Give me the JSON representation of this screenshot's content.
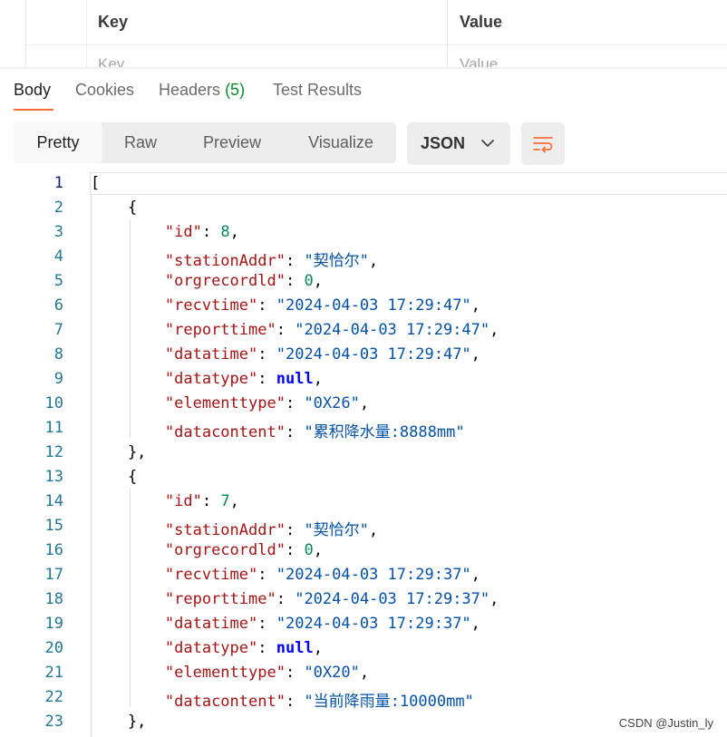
{
  "params": {
    "key_header": "Key",
    "value_header": "Value",
    "key_placeholder": "Key",
    "value_placeholder": "Value"
  },
  "tabs": [
    {
      "label": "Body"
    },
    {
      "label": "Cookies"
    },
    {
      "label": "Headers",
      "count": "(5)"
    },
    {
      "label": "Test Results"
    }
  ],
  "view_modes": [
    "Pretty",
    "Raw",
    "Preview",
    "Visualize"
  ],
  "format": {
    "selected": "JSON",
    "icon": "chevron-down-icon"
  },
  "wrap_icon": "wrap-lines-icon",
  "colors": {
    "accent": "#ff6c37",
    "line_number": "#237893",
    "json_key": "#a31515",
    "json_string": "#0451a5",
    "json_number": "#098658",
    "json_null": "#0000ff"
  },
  "code_lines": [
    [
      {
        "t": "[",
        "c": "p"
      }
    ],
    [
      {
        "t": "    {",
        "c": "p"
      }
    ],
    [
      {
        "t": "        ",
        "c": "p"
      },
      {
        "t": "\"id\"",
        "c": "k"
      },
      {
        "t": ": ",
        "c": "p"
      },
      {
        "t": "8",
        "c": "n"
      },
      {
        "t": ",",
        "c": "p"
      }
    ],
    [
      {
        "t": "        ",
        "c": "p"
      },
      {
        "t": "\"stationAddr\"",
        "c": "k"
      },
      {
        "t": ": ",
        "c": "p"
      },
      {
        "t": "\"契恰尔\"",
        "c": "s"
      },
      {
        "t": ",",
        "c": "p"
      }
    ],
    [
      {
        "t": "        ",
        "c": "p"
      },
      {
        "t": "\"orgrecordld\"",
        "c": "k"
      },
      {
        "t": ": ",
        "c": "p"
      },
      {
        "t": "0",
        "c": "n"
      },
      {
        "t": ",",
        "c": "p"
      }
    ],
    [
      {
        "t": "        ",
        "c": "p"
      },
      {
        "t": "\"recvtime\"",
        "c": "k"
      },
      {
        "t": ": ",
        "c": "p"
      },
      {
        "t": "\"2024-04-03 17:29:47\"",
        "c": "s"
      },
      {
        "t": ",",
        "c": "p"
      }
    ],
    [
      {
        "t": "        ",
        "c": "p"
      },
      {
        "t": "\"reporttime\"",
        "c": "k"
      },
      {
        "t": ": ",
        "c": "p"
      },
      {
        "t": "\"2024-04-03 17:29:47\"",
        "c": "s"
      },
      {
        "t": ",",
        "c": "p"
      }
    ],
    [
      {
        "t": "        ",
        "c": "p"
      },
      {
        "t": "\"datatime\"",
        "c": "k"
      },
      {
        "t": ": ",
        "c": "p"
      },
      {
        "t": "\"2024-04-03 17:29:47\"",
        "c": "s"
      },
      {
        "t": ",",
        "c": "p"
      }
    ],
    [
      {
        "t": "        ",
        "c": "p"
      },
      {
        "t": "\"datatype\"",
        "c": "k"
      },
      {
        "t": ": ",
        "c": "p"
      },
      {
        "t": "null",
        "c": "kw"
      },
      {
        "t": ",",
        "c": "p"
      }
    ],
    [
      {
        "t": "        ",
        "c": "p"
      },
      {
        "t": "\"elementtype\"",
        "c": "k"
      },
      {
        "t": ": ",
        "c": "p"
      },
      {
        "t": "\"0X26\"",
        "c": "s"
      },
      {
        "t": ",",
        "c": "p"
      }
    ],
    [
      {
        "t": "        ",
        "c": "p"
      },
      {
        "t": "\"datacontent\"",
        "c": "k"
      },
      {
        "t": ": ",
        "c": "p"
      },
      {
        "t": "\"累积降水量:8888mm\"",
        "c": "s"
      }
    ],
    [
      {
        "t": "    },",
        "c": "p"
      }
    ],
    [
      {
        "t": "    {",
        "c": "p"
      }
    ],
    [
      {
        "t": "        ",
        "c": "p"
      },
      {
        "t": "\"id\"",
        "c": "k"
      },
      {
        "t": ": ",
        "c": "p"
      },
      {
        "t": "7",
        "c": "n"
      },
      {
        "t": ",",
        "c": "p"
      }
    ],
    [
      {
        "t": "        ",
        "c": "p"
      },
      {
        "t": "\"stationAddr\"",
        "c": "k"
      },
      {
        "t": ": ",
        "c": "p"
      },
      {
        "t": "\"契恰尔\"",
        "c": "s"
      },
      {
        "t": ",",
        "c": "p"
      }
    ],
    [
      {
        "t": "        ",
        "c": "p"
      },
      {
        "t": "\"orgrecordld\"",
        "c": "k"
      },
      {
        "t": ": ",
        "c": "p"
      },
      {
        "t": "0",
        "c": "n"
      },
      {
        "t": ",",
        "c": "p"
      }
    ],
    [
      {
        "t": "        ",
        "c": "p"
      },
      {
        "t": "\"recvtime\"",
        "c": "k"
      },
      {
        "t": ": ",
        "c": "p"
      },
      {
        "t": "\"2024-04-03 17:29:37\"",
        "c": "s"
      },
      {
        "t": ",",
        "c": "p"
      }
    ],
    [
      {
        "t": "        ",
        "c": "p"
      },
      {
        "t": "\"reporttime\"",
        "c": "k"
      },
      {
        "t": ": ",
        "c": "p"
      },
      {
        "t": "\"2024-04-03 17:29:37\"",
        "c": "s"
      },
      {
        "t": ",",
        "c": "p"
      }
    ],
    [
      {
        "t": "        ",
        "c": "p"
      },
      {
        "t": "\"datatime\"",
        "c": "k"
      },
      {
        "t": ": ",
        "c": "p"
      },
      {
        "t": "\"2024-04-03 17:29:37\"",
        "c": "s"
      },
      {
        "t": ",",
        "c": "p"
      }
    ],
    [
      {
        "t": "        ",
        "c": "p"
      },
      {
        "t": "\"datatype\"",
        "c": "k"
      },
      {
        "t": ": ",
        "c": "p"
      },
      {
        "t": "null",
        "c": "kw"
      },
      {
        "t": ",",
        "c": "p"
      }
    ],
    [
      {
        "t": "        ",
        "c": "p"
      },
      {
        "t": "\"elementtype\"",
        "c": "k"
      },
      {
        "t": ": ",
        "c": "p"
      },
      {
        "t": "\"0X20\"",
        "c": "s"
      },
      {
        "t": ",",
        "c": "p"
      }
    ],
    [
      {
        "t": "        ",
        "c": "p"
      },
      {
        "t": "\"datacontent\"",
        "c": "k"
      },
      {
        "t": ": ",
        "c": "p"
      },
      {
        "t": "\"当前降雨量:10000mm\"",
        "c": "s"
      }
    ],
    [
      {
        "t": "    },",
        "c": "p"
      }
    ]
  ],
  "watermark": "CSDN @Justin_ly"
}
